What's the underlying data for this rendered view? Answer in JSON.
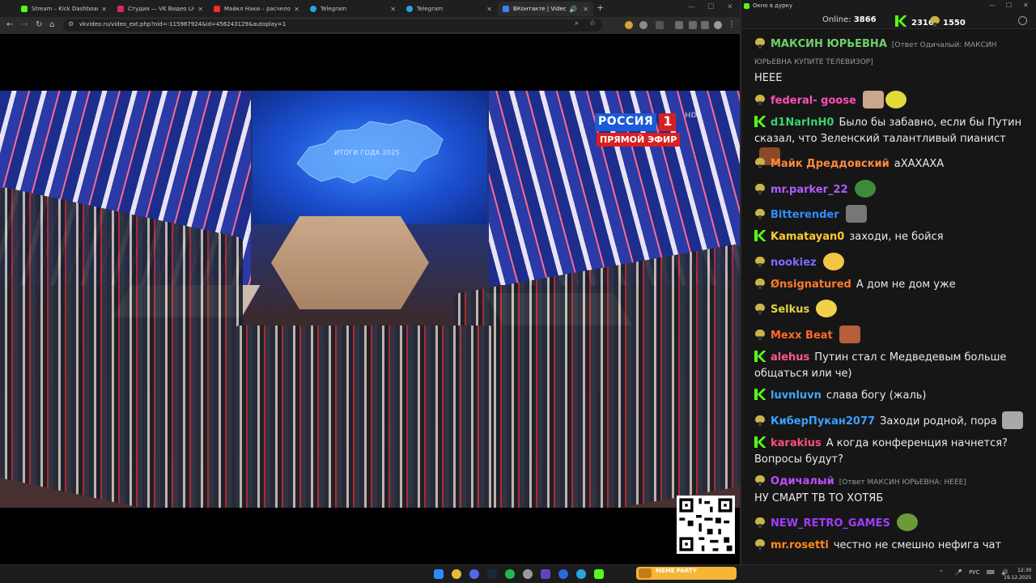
{
  "browser": {
    "tabs": [
      {
        "label": "Stream – Kick Dashboard",
        "color": "#53fc18"
      },
      {
        "label": "Студия — VK Видео Live",
        "color": "#e0245e"
      },
      {
        "label": "Майкл Наки – расчеловечивание",
        "color": "#ff2a2a"
      },
      {
        "label": "Telegram",
        "color": "#2aa3e0"
      },
      {
        "label": "Telegram",
        "color": "#2aa3e0"
      },
      {
        "label": "ВКонтакте | Video Ext",
        "color": "#3b82f6"
      }
    ],
    "url": "vkvideo.ru/video_ext.php?oid=-115987924&id=456243129&autoplay=1"
  },
  "video": {
    "screen_text": "ИТОГИ ГОДА 2025",
    "channel_name": "РОССИЯ",
    "channel_number": "1",
    "live_label": "ПРЯМОЙ ЭФИР",
    "hd_label": "HD"
  },
  "chat": {
    "window_title": "Окно в дурку",
    "online_label": "Online:",
    "online_count": "3866",
    "kick_count": "2316",
    "vk_count": "1550",
    "messages": [
      {
        "badge": "g",
        "nick": "МАКСИН ЮРЬЕВНА",
        "color": "#6fd06a",
        "reply": "[Ответ Одичалый: МАКСИН ЮРЬЕВНА КУПИТЕ ТЕЛЕВИЗОР]",
        "text": "НЕЕЕ"
      },
      {
        "badge": "g",
        "nick": "federal- goose",
        "color": "#ff4fb8",
        "text": ""
      },
      {
        "badge": "k",
        "nick": "d1NarInH0",
        "color": "#39d46a",
        "text": "Было бы забавно, если бы Путин сказал, что Зеленский талантливый пианист"
      },
      {
        "badge": "g",
        "nick": "Майк Дреддовский",
        "color": "#ff8a3d",
        "text": "аХАХАХА"
      },
      {
        "badge": "g",
        "nick": "mr.parker_22",
        "color": "#b05cff",
        "text": ""
      },
      {
        "badge": "g",
        "nick": "Bitterender",
        "color": "#2f8cff",
        "text": ""
      },
      {
        "badge": "k",
        "nick": "Kamatayan0",
        "color": "#ffcc33",
        "text": "заходи, не бойся"
      },
      {
        "badge": "g",
        "nick": "nookiez",
        "color": "#7a6dff",
        "text": ""
      },
      {
        "badge": "g",
        "nick": "Ønsignatured",
        "color": "#ff7b2e",
        "text": "А дом не дом уже"
      },
      {
        "badge": "g",
        "nick": "Selkus",
        "color": "#e6d24a",
        "text": ""
      },
      {
        "badge": "g",
        "nick": "Mexx Beat",
        "color": "#ff6a2a",
        "text": ""
      },
      {
        "badge": "k",
        "nick": "alehus",
        "color": "#ff5a8a",
        "text": "Путин стал с Медведевым больше общаться или че)"
      },
      {
        "badge": "k",
        "nick": "luvnluvn",
        "color": "#3fa8ff",
        "text": "слава богу (жаль)"
      },
      {
        "badge": "g",
        "nick": "КиберПукан2077",
        "color": "#3aa0ff",
        "text": "Заходи родной, пора"
      },
      {
        "badge": "k",
        "nick": "karakius",
        "color": "#ff4f7a",
        "text": "А когда конференция начнется? Вопросы будут?"
      },
      {
        "badge": "g",
        "nick": "Одичалый",
        "color": "#c04fff",
        "reply": "[Ответ МАКСИН ЮРЬЕВНА: НЕЕЕ]",
        "text": "НУ СМАРТ ТВ ТО ХОТЯБ"
      },
      {
        "badge": "g",
        "nick": "NEW_RETRO_GAMES",
        "color": "#a03cff",
        "text": ""
      },
      {
        "badge": "g",
        "nick": "mr.rosetti",
        "color": "#ff8a1a",
        "text": "честно не смешно нефига чат"
      }
    ]
  },
  "taskbar": {
    "widget_label": "MEME PARTY",
    "lang": "РУС",
    "time": "12:30",
    "date": "19.12.2025"
  }
}
